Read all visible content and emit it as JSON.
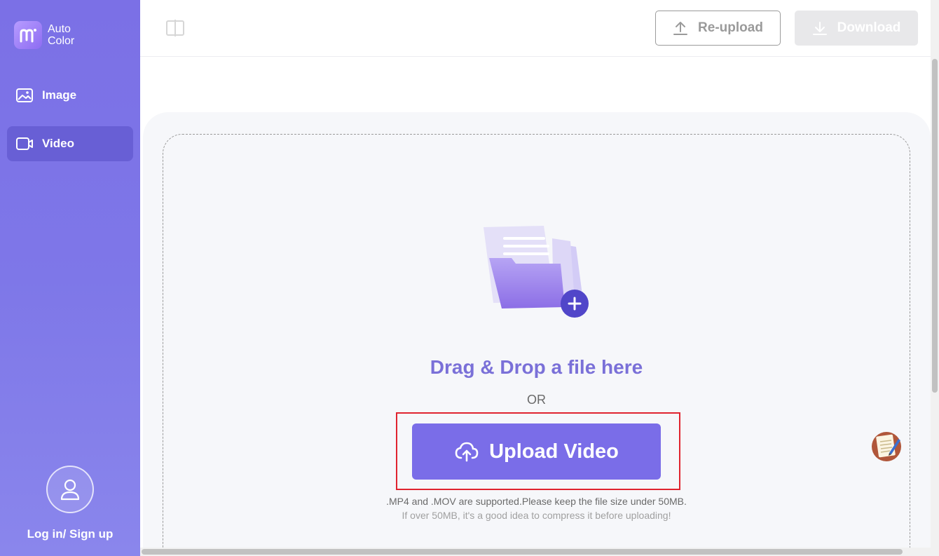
{
  "app": {
    "brand_line1": "Auto",
    "brand_line2": "Color"
  },
  "sidebar": {
    "items": [
      {
        "label": "Image",
        "icon": "image-icon",
        "active": false
      },
      {
        "label": "Video",
        "icon": "video-icon",
        "active": true
      }
    ],
    "login_label": "Log in/ Sign up"
  },
  "toolbar": {
    "reupload_label": "Re-upload",
    "download_label": "Download"
  },
  "upload": {
    "title": "Drag & Drop a file here",
    "or_label": "OR",
    "button_label": "Upload Video",
    "hint_supported": ".MP4 and .MOV are supported.Please keep the file size under 50MB.",
    "hint_compress": "If over 50MB, it's a good idea to compress it before uploading!"
  },
  "colors": {
    "accent": "#7a6de8",
    "sidebar": "#7b70e6",
    "highlight": "#e0242f",
    "title": "#7a70d8"
  }
}
